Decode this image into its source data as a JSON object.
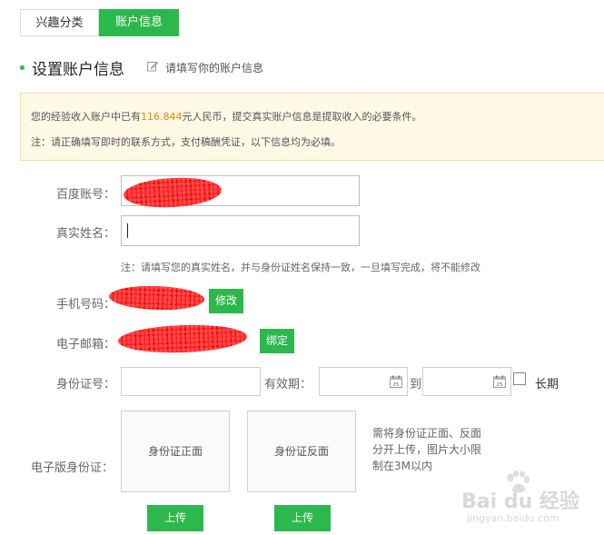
{
  "tabs": [
    {
      "label": "兴趣分类"
    },
    {
      "label": "账户信息"
    }
  ],
  "heading": "设置账户信息",
  "heading_hint": "请填写你的账户信息",
  "notice": {
    "line1_prefix": "您的经验收入账户中已有",
    "amount": "116.844",
    "line1_suffix": "元人民币，提交真实账户信息是提取收入的必要条件。",
    "line2": "注：请正确填写即时的联系方式，支付稿酬凭证，以下信息均为必填。"
  },
  "form": {
    "baidu_account_label": "百度账号：",
    "real_name_label": "真实姓名：",
    "real_name_note": "注：请填写您的真实姓名，并与身份证姓名保持一致，一旦填写完成，将不能修改",
    "phone_label": "手机号码：",
    "phone_button": "修改",
    "email_label": "电子邮箱：",
    "email_button": "绑定",
    "id_label": "身份证号：",
    "validity_label": "有效期：",
    "to_label": "到",
    "long_term_label": "长期",
    "calendar_day": "25",
    "eid_label": "电子版身份证：",
    "front_label": "身份证正面",
    "back_label": "身份证反面",
    "upload_button": "上传",
    "upload_note": "需将身份证正面、反面分开上传，图片大小限制在3M以内"
  },
  "watermark": {
    "logo": "Bai du 经验",
    "url": "jingyan.baidu.com"
  },
  "colors": {
    "accent_green": "#2db84d",
    "amount_orange": "#f08200",
    "notice_bg": "#fff9e6",
    "redaction_red": "#ff1d1d"
  }
}
